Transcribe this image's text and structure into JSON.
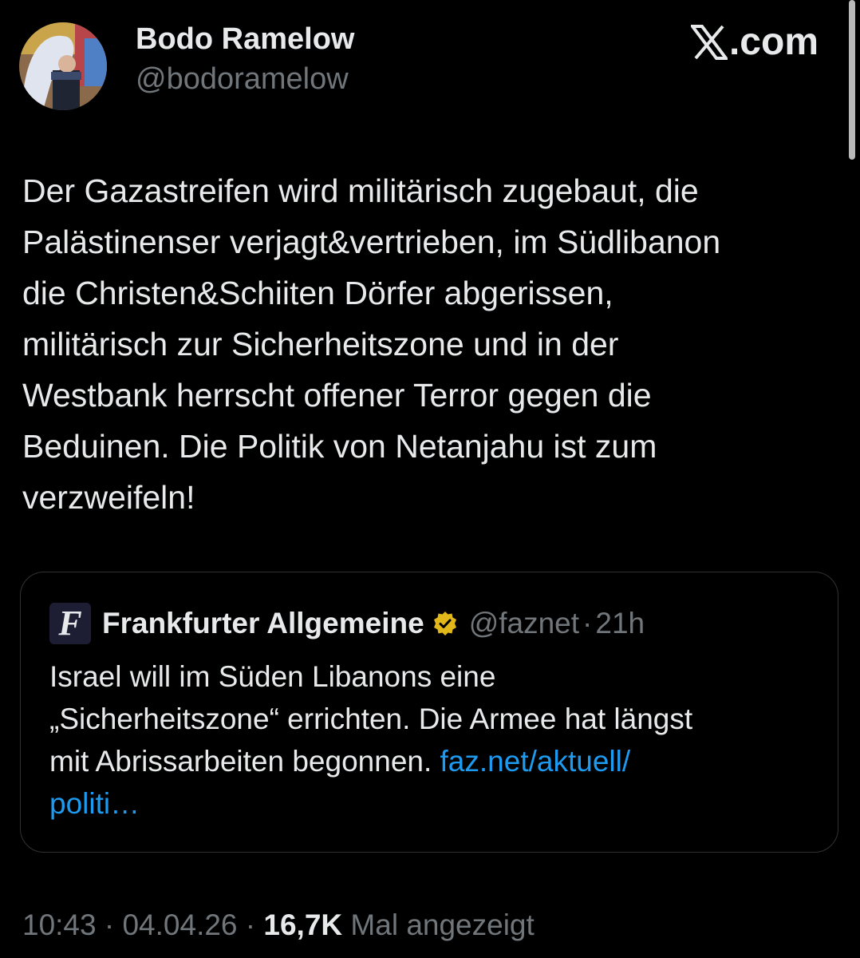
{
  "author": {
    "name": "Bodo Ramelow",
    "handle": "@bodoramelow"
  },
  "site_logo": {
    "icon": "x-logo-icon",
    "text": ".com"
  },
  "tweet": {
    "text": "Der Gazastreifen wird militärisch zugebaut, die\nPalästinenser verjagt&vertrieben, im Südlibanon\ndie Christen&Schiiten Dörfer abgerissen,\nmilitärisch zur Sicherheitszone und in der\nWestbank herrscht offener Terror gegen die\nBeduinen. Die Politik von Netanjahu ist zum\nverzweifeln!"
  },
  "quote": {
    "logo_letter": "F",
    "name": "Frankfurter Allgemeine",
    "verified_icon": "gold-verified-badge-icon",
    "handle": "@faznet",
    "separator": "·",
    "time": "21h",
    "line1": "Israel will im Süden Libanons eine",
    "line2": "„Sicherheitszone“ errichten. Die Armee hat längst",
    "line3": "mit Abrissarbeiten begonnen. ",
    "link_part1": "faz.net/aktuell/",
    "link_part2": "politi…"
  },
  "meta": {
    "time": "10:43",
    "separator": "·",
    "date": "04.04.26",
    "views_count": "16,7K",
    "views_label": "Mal angezeigt"
  },
  "colors": {
    "background": "#000000",
    "primary_text": "#e7e9ea",
    "secondary_text": "#71767b",
    "link": "#1d9bf0",
    "card_border": "#2f3336",
    "verified_gold": "#e2b719"
  }
}
